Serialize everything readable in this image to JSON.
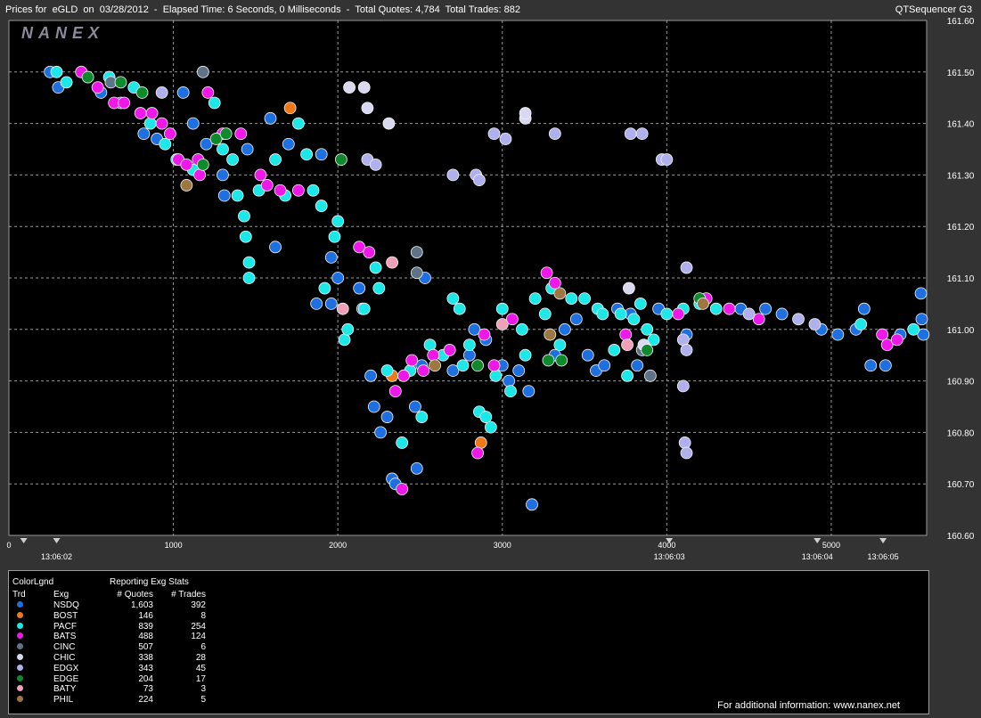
{
  "header": {
    "title": "Prices for  eGLD  on  03/28/2012  -  Elapsed Time: 6 Seconds, 0 Milliseconds  -  Total Quotes: 4,784  Total Trades: 882",
    "app_name": "QTSequencer G3",
    "watermark": "NANEX"
  },
  "colors": {
    "background": "#000000",
    "frame": "#333333",
    "grid": "#9a9a9a"
  },
  "chart_data": {
    "type": "scatter",
    "xlim": [
      0,
      5580
    ],
    "ylim": [
      160.6,
      161.6
    ],
    "x_ticks": [
      0,
      1000,
      2000,
      3000,
      4000,
      5000
    ],
    "y_ticks": [
      160.6,
      160.7,
      160.8,
      160.9,
      161.0,
      161.1,
      161.2,
      161.3,
      161.4,
      161.5,
      161.6
    ],
    "y_tick_labels": [
      "160.60",
      "160.70",
      "160.80",
      "160.90",
      "161.00",
      "161.10",
      "161.20",
      "161.30",
      "161.40",
      "161.50",
      "161.60"
    ],
    "time_markers": [
      {
        "x": 290,
        "label": "13:06:02"
      },
      {
        "x": 4015,
        "label": "13:06:03"
      },
      {
        "x": 4915,
        "label": "13:06:04"
      },
      {
        "x": 5315,
        "label": "13:06:05"
      }
    ],
    "series": [
      {
        "name": "NSDQ",
        "color": "#1e6fe0",
        "points": [
          [
            250,
            161.5
          ],
          [
            300,
            161.47
          ],
          [
            560,
            161.46
          ],
          [
            680,
            161.44
          ],
          [
            820,
            161.38
          ],
          [
            900,
            161.37
          ],
          [
            1060,
            161.46
          ],
          [
            1120,
            161.4
          ],
          [
            1200,
            161.36
          ],
          [
            1300,
            161.3
          ],
          [
            1310,
            161.26
          ],
          [
            1450,
            161.35
          ],
          [
            1590,
            161.41
          ],
          [
            1620,
            161.16
          ],
          [
            1700,
            161.36
          ],
          [
            1900,
            161.34
          ],
          [
            1960,
            161.14
          ],
          [
            2000,
            161.1
          ],
          [
            1870,
            161.05
          ],
          [
            1960,
            161.05
          ],
          [
            2130,
            161.08
          ],
          [
            2150,
            161.04
          ],
          [
            2200,
            160.91
          ],
          [
            2220,
            160.85
          ],
          [
            2260,
            160.8
          ],
          [
            2300,
            160.83
          ],
          [
            2330,
            160.71
          ],
          [
            2350,
            160.7
          ],
          [
            2480,
            160.73
          ],
          [
            2470,
            160.85
          ],
          [
            2510,
            160.93
          ],
          [
            2530,
            161.1
          ],
          [
            2700,
            160.92
          ],
          [
            2800,
            160.95
          ],
          [
            2830,
            161.0
          ],
          [
            2900,
            160.98
          ],
          [
            3000,
            160.93
          ],
          [
            3040,
            160.9
          ],
          [
            3100,
            160.92
          ],
          [
            3160,
            160.88
          ],
          [
            3180,
            160.66
          ],
          [
            3320,
            160.95
          ],
          [
            3380,
            161.0
          ],
          [
            3450,
            161.02
          ],
          [
            3520,
            160.95
          ],
          [
            3570,
            160.92
          ],
          [
            3620,
            160.93
          ],
          [
            3700,
            161.04
          ],
          [
            3780,
            161.03
          ],
          [
            3820,
            160.93
          ],
          [
            3950,
            161.04
          ],
          [
            4120,
            160.99
          ],
          [
            4450,
            161.04
          ],
          [
            4600,
            161.04
          ],
          [
            4700,
            161.03
          ],
          [
            4940,
            161.0
          ],
          [
            5040,
            160.99
          ],
          [
            5150,
            161.0
          ],
          [
            5200,
            161.04
          ],
          [
            5240,
            160.93
          ],
          [
            5330,
            160.93
          ],
          [
            5420,
            160.99
          ],
          [
            5545,
            161.07
          ],
          [
            5550,
            161.02
          ],
          [
            5560,
            160.99
          ]
        ]
      },
      {
        "name": "BOST",
        "color": "#f07818",
        "points": [
          [
            1710,
            161.43
          ],
          [
            2330,
            160.91
          ],
          [
            2870,
            160.78
          ]
        ]
      },
      {
        "name": "PACF",
        "color": "#1ce8e8",
        "points": [
          [
            290,
            161.5
          ],
          [
            350,
            161.48
          ],
          [
            610,
            161.49
          ],
          [
            760,
            161.47
          ],
          [
            860,
            161.4
          ],
          [
            950,
            161.36
          ],
          [
            1020,
            161.33
          ],
          [
            1120,
            161.31
          ],
          [
            1250,
            161.44
          ],
          [
            1300,
            161.35
          ],
          [
            1360,
            161.33
          ],
          [
            1390,
            161.26
          ],
          [
            1430,
            161.22
          ],
          [
            1440,
            161.18
          ],
          [
            1460,
            161.13
          ],
          [
            1460,
            161.1
          ],
          [
            1520,
            161.27
          ],
          [
            1620,
            161.33
          ],
          [
            1680,
            161.26
          ],
          [
            1760,
            161.4
          ],
          [
            1810,
            161.34
          ],
          [
            1850,
            161.27
          ],
          [
            1900,
            161.24
          ],
          [
            1980,
            161.18
          ],
          [
            2000,
            161.21
          ],
          [
            1920,
            161.08
          ],
          [
            2040,
            160.98
          ],
          [
            2060,
            161.0
          ],
          [
            2160,
            161.04
          ],
          [
            2230,
            161.12
          ],
          [
            2250,
            161.08
          ],
          [
            2300,
            160.92
          ],
          [
            2390,
            160.78
          ],
          [
            2440,
            160.92
          ],
          [
            2510,
            160.83
          ],
          [
            2560,
            160.97
          ],
          [
            2640,
            160.95
          ],
          [
            2700,
            161.06
          ],
          [
            2740,
            161.04
          ],
          [
            2760,
            160.93
          ],
          [
            2800,
            160.97
          ],
          [
            2860,
            160.84
          ],
          [
            2900,
            160.83
          ],
          [
            2930,
            160.81
          ],
          [
            2960,
            160.91
          ],
          [
            3000,
            161.04
          ],
          [
            3050,
            160.88
          ],
          [
            3120,
            161.0
          ],
          [
            3140,
            160.95
          ],
          [
            3200,
            161.06
          ],
          [
            3260,
            161.03
          ],
          [
            3300,
            161.08
          ],
          [
            3350,
            160.97
          ],
          [
            3420,
            161.06
          ],
          [
            3500,
            161.06
          ],
          [
            3580,
            161.04
          ],
          [
            3610,
            161.03
          ],
          [
            3680,
            160.96
          ],
          [
            3720,
            161.03
          ],
          [
            3760,
            160.91
          ],
          [
            3800,
            161.02
          ],
          [
            3840,
            161.05
          ],
          [
            3880,
            161.0
          ],
          [
            3920,
            160.98
          ],
          [
            4000,
            161.03
          ],
          [
            4100,
            161.04
          ],
          [
            4200,
            161.05
          ],
          [
            4300,
            161.04
          ],
          [
            5180,
            161.01
          ],
          [
            5500,
            161.0
          ]
        ]
      },
      {
        "name": "BATS",
        "color": "#f018e8",
        "points": [
          [
            440,
            161.5
          ],
          [
            540,
            161.47
          ],
          [
            640,
            161.44
          ],
          [
            700,
            161.44
          ],
          [
            800,
            161.42
          ],
          [
            870,
            161.42
          ],
          [
            930,
            161.4
          ],
          [
            980,
            161.38
          ],
          [
            1030,
            161.33
          ],
          [
            1080,
            161.32
          ],
          [
            1150,
            161.33
          ],
          [
            1160,
            161.3
          ],
          [
            1210,
            161.46
          ],
          [
            1300,
            161.38
          ],
          [
            1410,
            161.38
          ],
          [
            1530,
            161.3
          ],
          [
            1570,
            161.28
          ],
          [
            1650,
            161.27
          ],
          [
            1760,
            161.27
          ],
          [
            2130,
            161.16
          ],
          [
            2190,
            161.15
          ],
          [
            2350,
            160.88
          ],
          [
            2400,
            160.91
          ],
          [
            2450,
            160.94
          ],
          [
            2520,
            160.92
          ],
          [
            2580,
            160.95
          ],
          [
            2680,
            160.96
          ],
          [
            2850,
            160.76
          ],
          [
            2890,
            160.99
          ],
          [
            2950,
            160.93
          ],
          [
            3060,
            161.02
          ],
          [
            3270,
            161.11
          ],
          [
            3320,
            161.09
          ],
          [
            3750,
            160.99
          ],
          [
            4070,
            161.03
          ],
          [
            4240,
            161.06
          ],
          [
            4380,
            161.04
          ],
          [
            4560,
            161.02
          ],
          [
            5310,
            160.99
          ],
          [
            5340,
            160.97
          ],
          [
            5400,
            160.98
          ],
          [
            2390,
            160.69
          ]
        ]
      },
      {
        "name": "CINC",
        "color": "#5f7388",
        "points": [
          [
            620,
            161.48
          ],
          [
            1180,
            161.5
          ],
          [
            2480,
            161.15
          ],
          [
            2480,
            161.11
          ],
          [
            3900,
            160.91
          ],
          [
            3850,
            160.96
          ]
        ]
      },
      {
        "name": "CHIC",
        "color": "#d8d8f0",
        "points": [
          [
            2070,
            161.47
          ],
          [
            2160,
            161.47
          ],
          [
            2180,
            161.43
          ],
          [
            3140,
            161.41
          ],
          [
            3140,
            161.42
          ],
          [
            2310,
            161.4
          ],
          [
            3770,
            161.08
          ],
          [
            3860,
            160.97
          ]
        ]
      },
      {
        "name": "EDGX",
        "color": "#b0b0ee",
        "points": [
          [
            930,
            161.46
          ],
          [
            2180,
            161.33
          ],
          [
            2230,
            161.32
          ],
          [
            2700,
            161.3
          ],
          [
            2840,
            161.3
          ],
          [
            2860,
            161.29
          ],
          [
            2950,
            161.38
          ],
          [
            3020,
            161.37
          ],
          [
            3320,
            161.38
          ],
          [
            3780,
            161.38
          ],
          [
            3850,
            161.38
          ],
          [
            3970,
            161.33
          ],
          [
            4000,
            161.33
          ],
          [
            4120,
            161.12
          ],
          [
            4100,
            160.98
          ],
          [
            4120,
            160.96
          ],
          [
            4100,
            160.89
          ],
          [
            4110,
            160.78
          ],
          [
            4120,
            160.76
          ],
          [
            4500,
            161.03
          ],
          [
            4800,
            161.02
          ],
          [
            4900,
            161.01
          ]
        ]
      },
      {
        "name": "EDGE",
        "color": "#0e8a2c",
        "points": [
          [
            480,
            161.49
          ],
          [
            680,
            161.48
          ],
          [
            810,
            161.46
          ],
          [
            1180,
            161.32
          ],
          [
            1260,
            161.37
          ],
          [
            1320,
            161.38
          ],
          [
            2020,
            161.33
          ],
          [
            2850,
            160.93
          ],
          [
            3280,
            160.94
          ],
          [
            3360,
            160.94
          ],
          [
            3880,
            160.96
          ],
          [
            4200,
            161.06
          ]
        ]
      },
      {
        "name": "BATY",
        "color": "#f0a0b8",
        "points": [
          [
            2030,
            161.04
          ],
          [
            2330,
            161.13
          ],
          [
            3000,
            161.01
          ],
          [
            3760,
            160.97
          ]
        ]
      },
      {
        "name": "PHIL",
        "color": "#9c7840",
        "points": [
          [
            1080,
            161.28
          ],
          [
            2590,
            160.93
          ],
          [
            3290,
            160.99
          ],
          [
            3350,
            161.07
          ],
          [
            4220,
            161.05
          ]
        ]
      }
    ]
  },
  "legend": {
    "title": "ColorLgnd",
    "subtitle": "Reporting Exg Stats",
    "columns": {
      "trd": "Trd",
      "exg": "Exg",
      "quotes": "# Quotes",
      "trades": "# Trades"
    },
    "rows": [
      {
        "exg": "NSDQ",
        "quotes": "1,603",
        "trades": "392",
        "color": "#1e6fe0"
      },
      {
        "exg": "BOST",
        "quotes": "146",
        "trades": "8",
        "color": "#f07818"
      },
      {
        "exg": "PACF",
        "quotes": "839",
        "trades": "254",
        "color": "#1ce8e8"
      },
      {
        "exg": "BATS",
        "quotes": "488",
        "trades": "124",
        "color": "#f018e8"
      },
      {
        "exg": "CINC",
        "quotes": "507",
        "trades": "6",
        "color": "#5f7388"
      },
      {
        "exg": "CHIC",
        "quotes": "338",
        "trades": "28",
        "color": "#d8d8f0"
      },
      {
        "exg": "EDGX",
        "quotes": "343",
        "trades": "45",
        "color": "#b0b0ee"
      },
      {
        "exg": "EDGE",
        "quotes": "204",
        "trades": "17",
        "color": "#0e8a2c"
      },
      {
        "exg": "BATY",
        "quotes": "73",
        "trades": "3",
        "color": "#f0a0b8"
      },
      {
        "exg": "PHIL",
        "quotes": "224",
        "trades": "5",
        "color": "#9c7840"
      }
    ]
  },
  "footer": {
    "text": "For additional information: www.nanex.net"
  }
}
